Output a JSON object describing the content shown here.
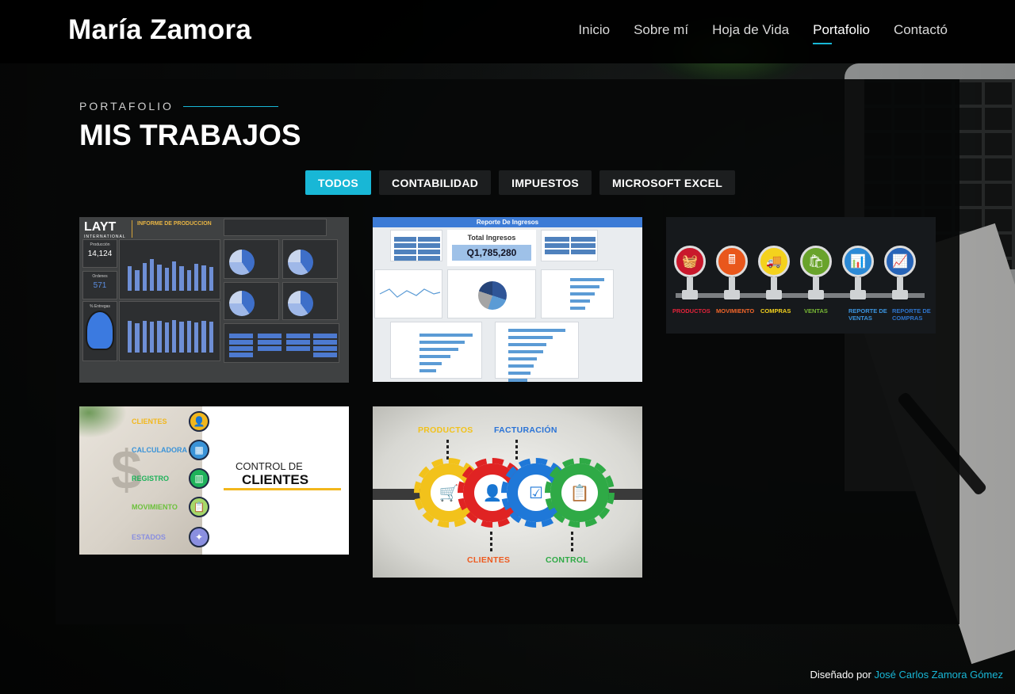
{
  "site": {
    "brand": "María Zamora"
  },
  "nav": {
    "items": [
      {
        "label": "Inicio"
      },
      {
        "label": "Sobre mí"
      },
      {
        "label": "Hoja de Vida"
      },
      {
        "label": "Portafolio"
      },
      {
        "label": "Contactó"
      }
    ],
    "active": "Portafolio"
  },
  "portfolio": {
    "eyebrow": "PORTAFOLIO",
    "title": "MIS TRABAJOS",
    "filters": [
      {
        "label": "TODOS"
      },
      {
        "label": "CONTABILIDAD"
      },
      {
        "label": "IMPUESTOS"
      },
      {
        "label": "MICROSOFT EXCEL"
      }
    ],
    "active_filter": "TODOS",
    "items": [
      {
        "logo": "LAYT",
        "logo_sub": "INTERNATIONAL",
        "title": "INFORME DE PRODUCCION",
        "kpi1_label": "Producción",
        "kpi1_value": "14,124",
        "kpi2_label": "Ordenes",
        "kpi2_value": "571",
        "kpi3_label": "% Entregas"
      },
      {
        "title": "Reporte De Ingresos",
        "total_label": "Total Ingresos",
        "total_value": "Q1,785,280"
      },
      {
        "steps": [
          "PRODUCTOS",
          "MOVIMIENTO",
          "COMPRAS",
          "VENTAS",
          "REPORTE DE VENTAS",
          "REPORTE DE COMPRAS"
        ]
      },
      {
        "rows": [
          "CLIENTES",
          "CALCULADORA",
          "REGISTRO",
          "MOVIMIENTO",
          "ESTADOS"
        ],
        "title_line1": "CONTROL DE",
        "title_line2": "CLIENTES"
      },
      {
        "labels": [
          "PRODUCTOS",
          "FACTURACIÓN",
          "CLIENTES",
          "CONTROL"
        ]
      }
    ]
  },
  "footer": {
    "prefix": "Diseñado por",
    "author": "José Carlos Zamora Gómez"
  },
  "colors": {
    "accent": "#18b7d6",
    "panel": "#060808",
    "filter_bg": "#1c1e1f"
  }
}
